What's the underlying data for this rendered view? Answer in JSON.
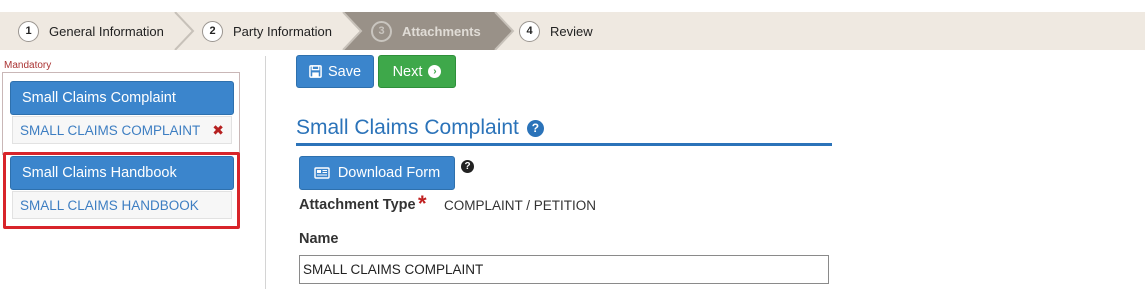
{
  "wizard": {
    "steps": [
      {
        "number": "1",
        "label": "General Information"
      },
      {
        "number": "2",
        "label": "Party Information"
      },
      {
        "number": "3",
        "label": "Attachments"
      },
      {
        "number": "4",
        "label": "Review"
      }
    ],
    "active_step": 3,
    "colors": {
      "bar": "#efe9e1",
      "active": "#999188"
    }
  },
  "sidebar": {
    "mandatory_label": "Mandatory",
    "documents": [
      {
        "title": "Small Claims Complaint",
        "file": "SMALL CLAIMS COMPLAINT",
        "removable": true
      },
      {
        "title": "Small Claims Handbook",
        "file": "SMALL CLAIMS HANDBOOK",
        "removable": false
      }
    ],
    "highlight_color": "#d8242a"
  },
  "toolbar": {
    "save_label": "Save",
    "save_icon": "floppy-disk-icon",
    "next_label": "Next",
    "next_icon": "chevron-circle-right-icon"
  },
  "form": {
    "section_title": "Small Claims Complaint",
    "download_label": "Download Form",
    "download_icon": "newspaper-icon",
    "attachment_type_label": "Attachment Type",
    "attachment_type_value": "COMPLAINT / PETITION",
    "name_label": "Name",
    "name_value": "SMALL CLAIMS COMPLAINT"
  },
  "colors": {
    "primary": "#3b85cc",
    "success": "#3ea84a",
    "title": "#2b73b9",
    "required": "#c02020"
  }
}
